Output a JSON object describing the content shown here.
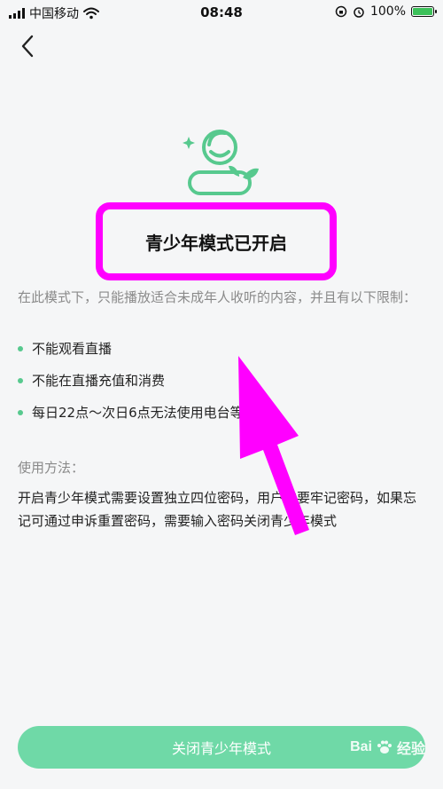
{
  "status_bar": {
    "carrier": "中国移动",
    "time": "08:48",
    "battery": "100%",
    "battery_level": 1.0
  },
  "mode": {
    "title": "青少年模式已开启"
  },
  "intro": "在此模式下，只能播放适合未成年人收听的内容，并且有以下限制：",
  "restrictions": [
    "不能观看直播",
    "不能在直播充值和消费",
    "每日22点～次日6点无法使用电台等功能"
  ],
  "usage": {
    "title": "使用方法：",
    "text": "开启青少年模式需要设置独立四位密码，用户需要牢记密码，如果忘记可通过申诉重置密码，需要输入密码关闭青少年模式"
  },
  "close_button_label": "关闭青少年模式",
  "watermark": {
    "brand": "Bai",
    "suffix": "经验"
  },
  "colors": {
    "accent_green": "#6fd9a7",
    "icon_green": "#57c98e",
    "annotation_magenta": "#ff00ff"
  },
  "icons": {
    "back": "chevron-left-icon",
    "hero": "youth-mode-icon"
  }
}
